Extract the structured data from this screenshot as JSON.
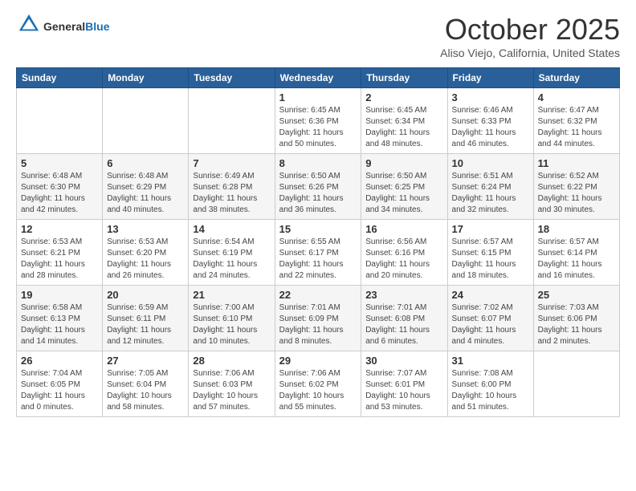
{
  "header": {
    "logo_general": "General",
    "logo_blue": "Blue",
    "month_title": "October 2025",
    "location": "Aliso Viejo, California, United States"
  },
  "days_of_week": [
    "Sunday",
    "Monday",
    "Tuesday",
    "Wednesday",
    "Thursday",
    "Friday",
    "Saturday"
  ],
  "weeks": [
    [
      {
        "day": "",
        "detail": ""
      },
      {
        "day": "",
        "detail": ""
      },
      {
        "day": "",
        "detail": ""
      },
      {
        "day": "1",
        "detail": "Sunrise: 6:45 AM\nSunset: 6:36 PM\nDaylight: 11 hours\nand 50 minutes."
      },
      {
        "day": "2",
        "detail": "Sunrise: 6:45 AM\nSunset: 6:34 PM\nDaylight: 11 hours\nand 48 minutes."
      },
      {
        "day": "3",
        "detail": "Sunrise: 6:46 AM\nSunset: 6:33 PM\nDaylight: 11 hours\nand 46 minutes."
      },
      {
        "day": "4",
        "detail": "Sunrise: 6:47 AM\nSunset: 6:32 PM\nDaylight: 11 hours\nand 44 minutes."
      }
    ],
    [
      {
        "day": "5",
        "detail": "Sunrise: 6:48 AM\nSunset: 6:30 PM\nDaylight: 11 hours\nand 42 minutes."
      },
      {
        "day": "6",
        "detail": "Sunrise: 6:48 AM\nSunset: 6:29 PM\nDaylight: 11 hours\nand 40 minutes."
      },
      {
        "day": "7",
        "detail": "Sunrise: 6:49 AM\nSunset: 6:28 PM\nDaylight: 11 hours\nand 38 minutes."
      },
      {
        "day": "8",
        "detail": "Sunrise: 6:50 AM\nSunset: 6:26 PM\nDaylight: 11 hours\nand 36 minutes."
      },
      {
        "day": "9",
        "detail": "Sunrise: 6:50 AM\nSunset: 6:25 PM\nDaylight: 11 hours\nand 34 minutes."
      },
      {
        "day": "10",
        "detail": "Sunrise: 6:51 AM\nSunset: 6:24 PM\nDaylight: 11 hours\nand 32 minutes."
      },
      {
        "day": "11",
        "detail": "Sunrise: 6:52 AM\nSunset: 6:22 PM\nDaylight: 11 hours\nand 30 minutes."
      }
    ],
    [
      {
        "day": "12",
        "detail": "Sunrise: 6:53 AM\nSunset: 6:21 PM\nDaylight: 11 hours\nand 28 minutes."
      },
      {
        "day": "13",
        "detail": "Sunrise: 6:53 AM\nSunset: 6:20 PM\nDaylight: 11 hours\nand 26 minutes."
      },
      {
        "day": "14",
        "detail": "Sunrise: 6:54 AM\nSunset: 6:19 PM\nDaylight: 11 hours\nand 24 minutes."
      },
      {
        "day": "15",
        "detail": "Sunrise: 6:55 AM\nSunset: 6:17 PM\nDaylight: 11 hours\nand 22 minutes."
      },
      {
        "day": "16",
        "detail": "Sunrise: 6:56 AM\nSunset: 6:16 PM\nDaylight: 11 hours\nand 20 minutes."
      },
      {
        "day": "17",
        "detail": "Sunrise: 6:57 AM\nSunset: 6:15 PM\nDaylight: 11 hours\nand 18 minutes."
      },
      {
        "day": "18",
        "detail": "Sunrise: 6:57 AM\nSunset: 6:14 PM\nDaylight: 11 hours\nand 16 minutes."
      }
    ],
    [
      {
        "day": "19",
        "detail": "Sunrise: 6:58 AM\nSunset: 6:13 PM\nDaylight: 11 hours\nand 14 minutes."
      },
      {
        "day": "20",
        "detail": "Sunrise: 6:59 AM\nSunset: 6:11 PM\nDaylight: 11 hours\nand 12 minutes."
      },
      {
        "day": "21",
        "detail": "Sunrise: 7:00 AM\nSunset: 6:10 PM\nDaylight: 11 hours\nand 10 minutes."
      },
      {
        "day": "22",
        "detail": "Sunrise: 7:01 AM\nSunset: 6:09 PM\nDaylight: 11 hours\nand 8 minutes."
      },
      {
        "day": "23",
        "detail": "Sunrise: 7:01 AM\nSunset: 6:08 PM\nDaylight: 11 hours\nand 6 minutes."
      },
      {
        "day": "24",
        "detail": "Sunrise: 7:02 AM\nSunset: 6:07 PM\nDaylight: 11 hours\nand 4 minutes."
      },
      {
        "day": "25",
        "detail": "Sunrise: 7:03 AM\nSunset: 6:06 PM\nDaylight: 11 hours\nand 2 minutes."
      }
    ],
    [
      {
        "day": "26",
        "detail": "Sunrise: 7:04 AM\nSunset: 6:05 PM\nDaylight: 11 hours\nand 0 minutes."
      },
      {
        "day": "27",
        "detail": "Sunrise: 7:05 AM\nSunset: 6:04 PM\nDaylight: 10 hours\nand 58 minutes."
      },
      {
        "day": "28",
        "detail": "Sunrise: 7:06 AM\nSunset: 6:03 PM\nDaylight: 10 hours\nand 57 minutes."
      },
      {
        "day": "29",
        "detail": "Sunrise: 7:06 AM\nSunset: 6:02 PM\nDaylight: 10 hours\nand 55 minutes."
      },
      {
        "day": "30",
        "detail": "Sunrise: 7:07 AM\nSunset: 6:01 PM\nDaylight: 10 hours\nand 53 minutes."
      },
      {
        "day": "31",
        "detail": "Sunrise: 7:08 AM\nSunset: 6:00 PM\nDaylight: 10 hours\nand 51 minutes."
      },
      {
        "day": "",
        "detail": ""
      }
    ]
  ]
}
